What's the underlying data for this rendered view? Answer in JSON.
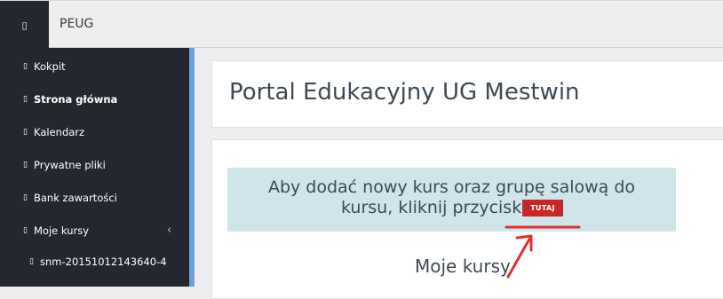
{
  "topbar": {
    "menu_icon": "menu-icon",
    "menu_glyph": "▯",
    "brand": "PEUG"
  },
  "sidebar": {
    "items": [
      {
        "glyph": "▯",
        "label": "Kokpit"
      },
      {
        "glyph": "▯",
        "label": "Strona główna"
      },
      {
        "glyph": "▯",
        "label": "Kalendarz"
      },
      {
        "glyph": "▯",
        "label": "Prywatne pliki"
      },
      {
        "glyph": "▯",
        "label": "Bank zawartości"
      },
      {
        "glyph": "▯",
        "label": "Moje kursy"
      },
      {
        "glyph": "▯",
        "label": "snm-20151012143640-4"
      }
    ],
    "caret": "‹",
    "accent_color": "#6f9fd9"
  },
  "main": {
    "page_title": "Portal Edukacyjny UG Mestwin",
    "notice": {
      "line1": "Aby dodać nowy kurs oraz grupę salową do",
      "line2": "kursu, kliknij przycisk",
      "button_label": "TUTAJ",
      "button_color": "#c62828",
      "background_color": "#cfe5ea"
    },
    "courses_heading": "Moje kursy",
    "annotation_color": "#e03030"
  }
}
